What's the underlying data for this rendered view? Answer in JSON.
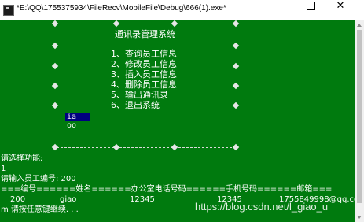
{
  "window": {
    "title": "*E:\\QQ\\1755375934\\FileRecv\\MobileFile\\Debug\\666(1).exe*",
    "minimize_glyph": "—",
    "close_glyph": "✕"
  },
  "menu": {
    "heading": "通讯录管理系统",
    "items": [
      "1、查询员工信息",
      "2、修改员工信息",
      "3、插入员工信息",
      "4、删除员工信息",
      "5、输出通讯录",
      "6、退出系统"
    ],
    "cursor_text": "ia oo"
  },
  "output": {
    "prompt_choice": "请选择功能:",
    "choice_value": "1",
    "prompt_id": "请输入员工编号: 200",
    "table_header": "===编号======姓名======办公室电话号码======手机号码======邮箱===",
    "row": {
      "id": "200",
      "name": "giao",
      "office_phone": "12345",
      "mobile": "12345",
      "email": "1755849998@qq.com"
    },
    "continue_prompt": "m 请按任意键继续. . ."
  },
  "watermark": "https://blog.csdn.net/l_giao_u"
}
